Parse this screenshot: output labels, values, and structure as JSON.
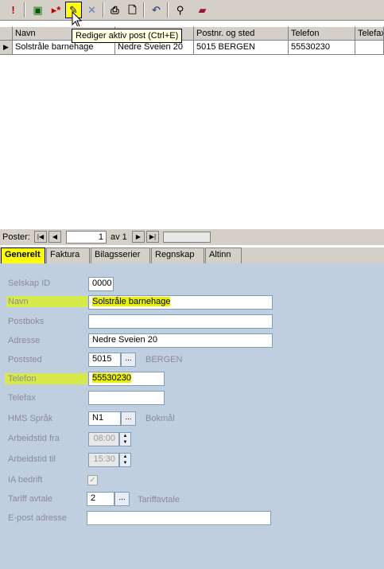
{
  "toolbar": {
    "buttons": [
      {
        "name": "alert",
        "glyph": "!"
      },
      {
        "name": "save",
        "glyph": "▣"
      },
      {
        "name": "new",
        "glyph": "▸*"
      },
      {
        "name": "edit",
        "glyph": "✎"
      },
      {
        "name": "delete",
        "glyph": "✕"
      },
      {
        "name": "print",
        "glyph": "⎙"
      },
      {
        "name": "preview",
        "glyph": "🗋"
      },
      {
        "name": "undo",
        "glyph": "↶"
      },
      {
        "name": "search",
        "glyph": "⚲"
      },
      {
        "name": "book",
        "glyph": "▰"
      }
    ],
    "tooltip": "Rediger aktiv post (Ctrl+E)"
  },
  "grid": {
    "columns": [
      "Navn",
      "",
      "Postnr. og sted",
      "Telefon",
      "Telefax"
    ],
    "rows": [
      [
        "Solstråle barnehage",
        "Nedre Sveien 20",
        "5015 BERGEN",
        "55530230",
        ""
      ]
    ]
  },
  "navigator": {
    "label": "Poster:",
    "current": "1",
    "of": "av 1"
  },
  "tabs": [
    "Generelt",
    "Faktura",
    "Bilagsserier",
    "Regnskap",
    "Altinn"
  ],
  "form": {
    "selskap_id_label": "Selskap ID",
    "selskap_id_value": "0000",
    "navn_label": "Navn",
    "navn_value": "Solstråle barnehage",
    "postboks_label": "Postboks",
    "postboks_value": "",
    "adresse_label": "Adresse",
    "adresse_value": "Nedre Sveien 20",
    "poststed_label": "Poststed",
    "poststed_value": "5015",
    "poststed_city": "BERGEN",
    "telefon_label": "Telefon",
    "telefon_value": "55530230",
    "telefax_label": "Telefax",
    "telefax_value": "",
    "hms_label": "HMS Språk",
    "hms_value": "N1",
    "hms_text": "Bokmål",
    "arb_fra_label": "Arbeidstid fra",
    "arb_fra_value": "08:00",
    "arb_til_label": "Arbeidstid til",
    "arb_til_value": "15:30",
    "ia_label": "IA bedrift",
    "tariff_label": "Tariff avtale",
    "tariff_value": "2",
    "tariff_text": "Tariffavtale",
    "epost_label": "E-post adresse",
    "epost_value": ""
  },
  "colors": {
    "highlight": "#e8f200",
    "panel": "#c0cfe0",
    "chrome": "#d4d0c8"
  }
}
